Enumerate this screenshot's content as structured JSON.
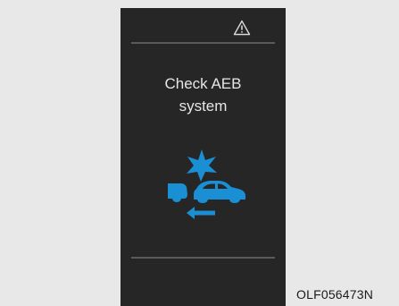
{
  "display": {
    "message_line1": "Check AEB",
    "message_line2": "system",
    "warning_icon": "warning-triangle-icon",
    "aeb_icon": "aeb-collision-warning-icon",
    "accent_color": "#1a8fd4",
    "text_color": "#e6e6e6",
    "background_color": "#262626"
  },
  "figure_code": "OLF056473N"
}
